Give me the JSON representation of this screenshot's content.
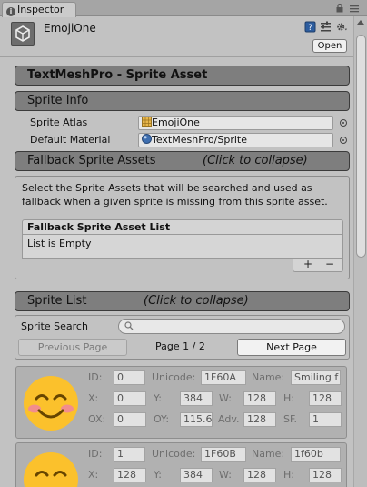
{
  "window": {
    "tab_label": "Inspector"
  },
  "header": {
    "object_name": "EmojiOne",
    "open_label": "Open"
  },
  "sections": {
    "main_title": "TextMeshPro - Sprite Asset",
    "sprite_info": "Sprite Info",
    "fallback": "Fallback Sprite Assets",
    "fallback_collapse_hint": "(Click to collapse)",
    "sprite_list": "Sprite List",
    "sprite_list_collapse_hint": "(Click to collapse)"
  },
  "sprite_info": {
    "atlas_label": "Sprite Atlas",
    "atlas_value": "EmojiOne",
    "material_label": "Default Material",
    "material_value": "TextMeshPro/Sprite"
  },
  "fallback": {
    "description": "Select the Sprite Assets that will be searched and used as fallback when a given sprite is missing from this sprite asset.",
    "list_header": "Fallback Sprite Asset List",
    "list_empty": "List is Empty",
    "add_label": "+",
    "remove_label": "−"
  },
  "sprite_list": {
    "search_label": "Sprite Search",
    "search_placeholder": "",
    "prev_label": "Previous Page",
    "next_label": "Next Page",
    "page_text": "Page 1 / 2"
  },
  "field_labels": {
    "id": "ID:",
    "unicode": "Unicode:",
    "name": "Name:",
    "x": "X:",
    "y": "Y:",
    "w": "W:",
    "h": "H:",
    "ox": "OX:",
    "oy": "OY:",
    "adv": "Adv.",
    "sf": "SF."
  },
  "sprites": [
    {
      "id": "0",
      "unicode": "1F60A",
      "name": "Smiling f",
      "x": "0",
      "y": "384",
      "w": "128",
      "h": "128",
      "ox": "0",
      "oy": "115.6",
      "adv": "128",
      "sf": "1"
    },
    {
      "id": "1",
      "unicode": "1F60B",
      "name": "1f60b",
      "x": "128",
      "y": "384",
      "w": "128",
      "h": "128"
    }
  ],
  "colors": {
    "section_bar": "#7e7e7e",
    "panel_bg": "#c2c2c2",
    "emoji_face": "#fbc12c"
  }
}
